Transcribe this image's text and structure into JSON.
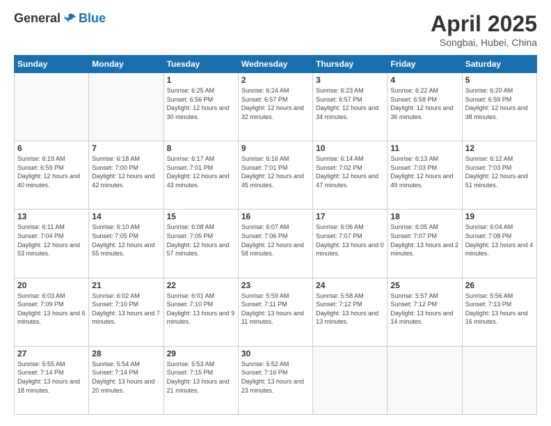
{
  "logo": {
    "general": "General",
    "blue": "Blue"
  },
  "header": {
    "month": "April 2025",
    "location": "Songbai, Hubei, China"
  },
  "weekdays": [
    "Sunday",
    "Monday",
    "Tuesday",
    "Wednesday",
    "Thursday",
    "Friday",
    "Saturday"
  ],
  "weeks": [
    [
      {
        "day": "",
        "info": ""
      },
      {
        "day": "",
        "info": ""
      },
      {
        "day": "1",
        "info": "Sunrise: 6:25 AM\nSunset: 6:56 PM\nDaylight: 12 hours and 30 minutes."
      },
      {
        "day": "2",
        "info": "Sunrise: 6:24 AM\nSunset: 6:57 PM\nDaylight: 12 hours and 32 minutes."
      },
      {
        "day": "3",
        "info": "Sunrise: 6:23 AM\nSunset: 6:57 PM\nDaylight: 12 hours and 34 minutes."
      },
      {
        "day": "4",
        "info": "Sunrise: 6:22 AM\nSunset: 6:58 PM\nDaylight: 12 hours and 36 minutes."
      },
      {
        "day": "5",
        "info": "Sunrise: 6:20 AM\nSunset: 6:59 PM\nDaylight: 12 hours and 38 minutes."
      }
    ],
    [
      {
        "day": "6",
        "info": "Sunrise: 6:19 AM\nSunset: 6:59 PM\nDaylight: 12 hours and 40 minutes."
      },
      {
        "day": "7",
        "info": "Sunrise: 6:18 AM\nSunset: 7:00 PM\nDaylight: 12 hours and 42 minutes."
      },
      {
        "day": "8",
        "info": "Sunrise: 6:17 AM\nSunset: 7:01 PM\nDaylight: 12 hours and 43 minutes."
      },
      {
        "day": "9",
        "info": "Sunrise: 6:16 AM\nSunset: 7:01 PM\nDaylight: 12 hours and 45 minutes."
      },
      {
        "day": "10",
        "info": "Sunrise: 6:14 AM\nSunset: 7:02 PM\nDaylight: 12 hours and 47 minutes."
      },
      {
        "day": "11",
        "info": "Sunrise: 6:13 AM\nSunset: 7:03 PM\nDaylight: 12 hours and 49 minutes."
      },
      {
        "day": "12",
        "info": "Sunrise: 6:12 AM\nSunset: 7:03 PM\nDaylight: 12 hours and 51 minutes."
      }
    ],
    [
      {
        "day": "13",
        "info": "Sunrise: 6:11 AM\nSunset: 7:04 PM\nDaylight: 12 hours and 53 minutes."
      },
      {
        "day": "14",
        "info": "Sunrise: 6:10 AM\nSunset: 7:05 PM\nDaylight: 12 hours and 55 minutes."
      },
      {
        "day": "15",
        "info": "Sunrise: 6:08 AM\nSunset: 7:05 PM\nDaylight: 12 hours and 57 minutes."
      },
      {
        "day": "16",
        "info": "Sunrise: 6:07 AM\nSunset: 7:06 PM\nDaylight: 12 hours and 58 minutes."
      },
      {
        "day": "17",
        "info": "Sunrise: 6:06 AM\nSunset: 7:07 PM\nDaylight: 13 hours and 0 minutes."
      },
      {
        "day": "18",
        "info": "Sunrise: 6:05 AM\nSunset: 7:07 PM\nDaylight: 13 hours and 2 minutes."
      },
      {
        "day": "19",
        "info": "Sunrise: 6:04 AM\nSunset: 7:08 PM\nDaylight: 13 hours and 4 minutes."
      }
    ],
    [
      {
        "day": "20",
        "info": "Sunrise: 6:03 AM\nSunset: 7:09 PM\nDaylight: 13 hours and 6 minutes."
      },
      {
        "day": "21",
        "info": "Sunrise: 6:02 AM\nSunset: 7:10 PM\nDaylight: 13 hours and 7 minutes."
      },
      {
        "day": "22",
        "info": "Sunrise: 6:01 AM\nSunset: 7:10 PM\nDaylight: 13 hours and 9 minutes."
      },
      {
        "day": "23",
        "info": "Sunrise: 5:59 AM\nSunset: 7:11 PM\nDaylight: 13 hours and 11 minutes."
      },
      {
        "day": "24",
        "info": "Sunrise: 5:58 AM\nSunset: 7:12 PM\nDaylight: 13 hours and 13 minutes."
      },
      {
        "day": "25",
        "info": "Sunrise: 5:57 AM\nSunset: 7:12 PM\nDaylight: 13 hours and 14 minutes."
      },
      {
        "day": "26",
        "info": "Sunrise: 5:56 AM\nSunset: 7:13 PM\nDaylight: 13 hours and 16 minutes."
      }
    ],
    [
      {
        "day": "27",
        "info": "Sunrise: 5:55 AM\nSunset: 7:14 PM\nDaylight: 13 hours and 18 minutes."
      },
      {
        "day": "28",
        "info": "Sunrise: 5:54 AM\nSunset: 7:14 PM\nDaylight: 13 hours and 20 minutes."
      },
      {
        "day": "29",
        "info": "Sunrise: 5:53 AM\nSunset: 7:15 PM\nDaylight: 13 hours and 21 minutes."
      },
      {
        "day": "30",
        "info": "Sunrise: 5:52 AM\nSunset: 7:16 PM\nDaylight: 13 hours and 23 minutes."
      },
      {
        "day": "",
        "info": ""
      },
      {
        "day": "",
        "info": ""
      },
      {
        "day": "",
        "info": ""
      }
    ]
  ]
}
